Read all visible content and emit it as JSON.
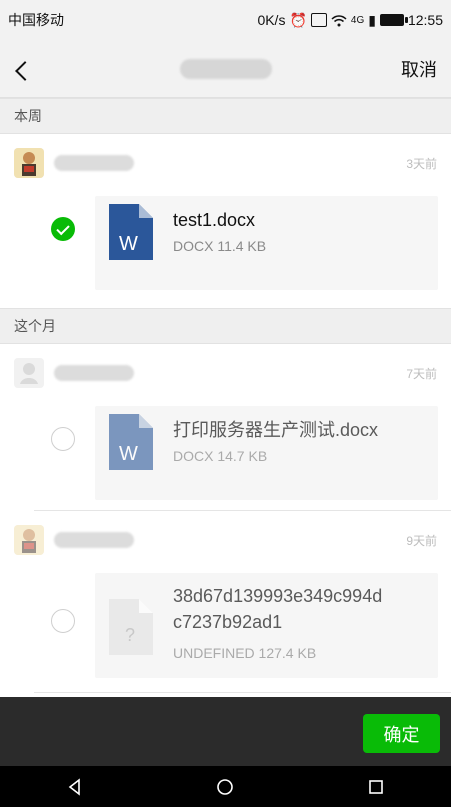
{
  "status_bar": {
    "carrier": "中国移动",
    "speed": "0K/s",
    "network": "4G",
    "time": "12:55"
  },
  "nav": {
    "cancel_label": "取消"
  },
  "sections": [
    {
      "title": "本周",
      "groups": [
        {
          "time": "3天前",
          "file": {
            "name": "test1.docx",
            "meta": "DOCX 11.4 KB",
            "icon": "word-doc-icon",
            "selected": true
          }
        }
      ]
    },
    {
      "title": "这个月",
      "groups": [
        {
          "time": "7天前",
          "file": {
            "name": "打印服务器生产测试.docx",
            "meta": "DOCX 14.7 KB",
            "icon": "word-doc-icon",
            "selected": false
          }
        },
        {
          "time": "9天前",
          "file": {
            "name_line1": "38d67d139993e349c994d",
            "name_line2": "c7237b92ad1",
            "meta": "UNDEFINED 127.4 KB",
            "icon": "unknown-file-icon",
            "selected": false
          }
        }
      ]
    }
  ],
  "footer": {
    "confirm_label": "确定"
  },
  "colors": {
    "accent_green": "#09bb07",
    "word_blue": "#2b579a",
    "dark_bar": "#2b2b2b"
  }
}
